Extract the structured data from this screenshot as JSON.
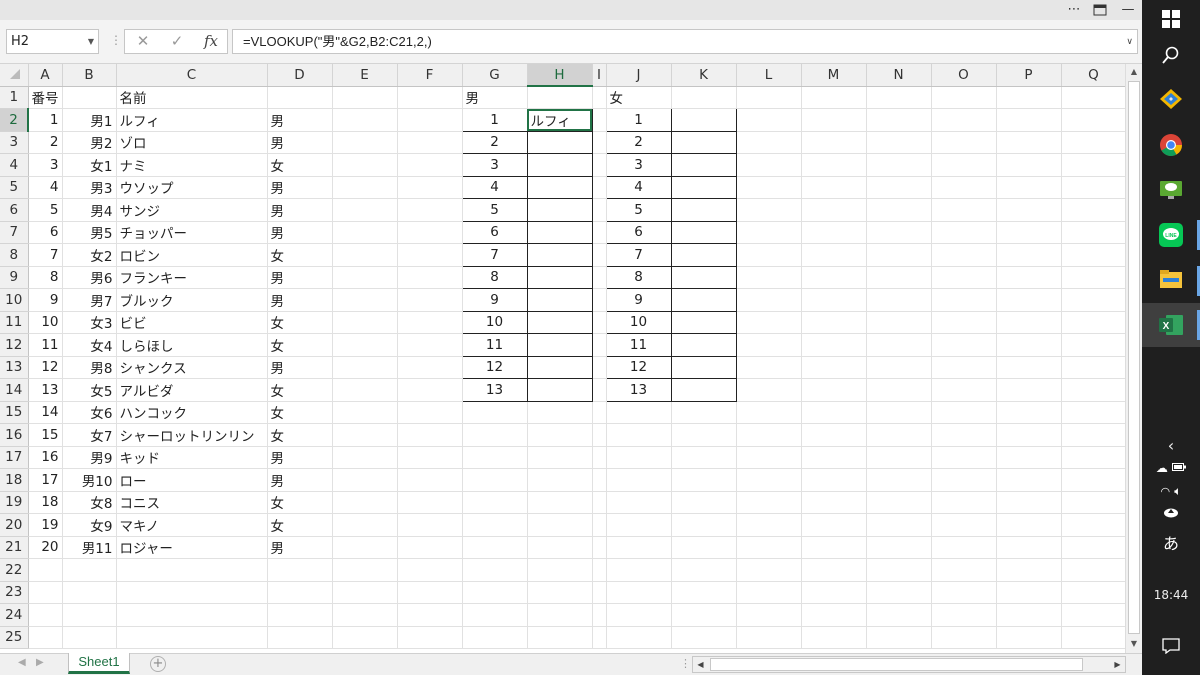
{
  "window": {
    "more_icon": "more-icon",
    "restore_icon": "restore-icon",
    "minimize_icon": "minimize-icon"
  },
  "formula_bar": {
    "name_box": "H2",
    "cancel_icon": "✕",
    "enter_icon": "✓",
    "fx_label": "fx",
    "formula": "=VLOOKUP(\"男\"&G2,B2:C21,2,)"
  },
  "columns": [
    "A",
    "B",
    "C",
    "D",
    "E",
    "F",
    "G",
    "H",
    "I",
    "J",
    "K",
    "L",
    "M",
    "N",
    "O",
    "P",
    "Q"
  ],
  "selected_column": "H",
  "selected_row": 2,
  "row_numbers": [
    1,
    2,
    3,
    4,
    5,
    6,
    7,
    8,
    9,
    10,
    11,
    12,
    13,
    14,
    15,
    16,
    17,
    18,
    19,
    20,
    21,
    22,
    23,
    24,
    25
  ],
  "header_row": {
    "A": "番号",
    "C": "名前",
    "G": "男",
    "J": "女"
  },
  "members": [
    {
      "no": "1",
      "code": "男1",
      "name": "ルフィ",
      "gender": "男"
    },
    {
      "no": "2",
      "code": "男2",
      "name": "ゾロ",
      "gender": "男"
    },
    {
      "no": "3",
      "code": "女1",
      "name": "ナミ",
      "gender": "女"
    },
    {
      "no": "4",
      "code": "男3",
      "name": "ウソップ",
      "gender": "男"
    },
    {
      "no": "5",
      "code": "男4",
      "name": "サンジ",
      "gender": "男"
    },
    {
      "no": "6",
      "code": "男5",
      "name": "チョッパー",
      "gender": "男"
    },
    {
      "no": "7",
      "code": "女2",
      "name": "ロビン",
      "gender": "女"
    },
    {
      "no": "8",
      "code": "男6",
      "name": "フランキー",
      "gender": "男"
    },
    {
      "no": "9",
      "code": "男7",
      "name": "ブルック",
      "gender": "男"
    },
    {
      "no": "10",
      "code": "女3",
      "name": "ビビ",
      "gender": "女"
    },
    {
      "no": "11",
      "code": "女4",
      "name": "しらほし",
      "gender": "女"
    },
    {
      "no": "12",
      "code": "男8",
      "name": "シャンクス",
      "gender": "男"
    },
    {
      "no": "13",
      "code": "女5",
      "name": "アルビダ",
      "gender": "女"
    },
    {
      "no": "14",
      "code": "女6",
      "name": "ハンコック",
      "gender": "女"
    },
    {
      "no": "15",
      "code": "女7",
      "name": "シャーロットリンリン",
      "gender": "女"
    },
    {
      "no": "16",
      "code": "男9",
      "name": "キッド",
      "gender": "男"
    },
    {
      "no": "17",
      "code": "男10",
      "name": "ロー",
      "gender": "男"
    },
    {
      "no": "18",
      "code": "女8",
      "name": "コニス",
      "gender": "女"
    },
    {
      "no": "19",
      "code": "女9",
      "name": "マキノ",
      "gender": "女"
    },
    {
      "no": "20",
      "code": "男11",
      "name": "ロジャー",
      "gender": "男"
    }
  ],
  "male_table": [
    {
      "n": "1",
      "name": "ルフィ"
    },
    {
      "n": "2",
      "name": ""
    },
    {
      "n": "3",
      "name": ""
    },
    {
      "n": "4",
      "name": ""
    },
    {
      "n": "5",
      "name": ""
    },
    {
      "n": "6",
      "name": ""
    },
    {
      "n": "7",
      "name": ""
    },
    {
      "n": "8",
      "name": ""
    },
    {
      "n": "9",
      "name": ""
    },
    {
      "n": "10",
      "name": ""
    },
    {
      "n": "11",
      "name": ""
    },
    {
      "n": "12",
      "name": ""
    },
    {
      "n": "13",
      "name": ""
    }
  ],
  "female_table": [
    {
      "n": "1",
      "name": ""
    },
    {
      "n": "2",
      "name": ""
    },
    {
      "n": "3",
      "name": ""
    },
    {
      "n": "4",
      "name": ""
    },
    {
      "n": "5",
      "name": ""
    },
    {
      "n": "6",
      "name": ""
    },
    {
      "n": "7",
      "name": ""
    },
    {
      "n": "8",
      "name": ""
    },
    {
      "n": "9",
      "name": ""
    },
    {
      "n": "10",
      "name": ""
    },
    {
      "n": "11",
      "name": ""
    },
    {
      "n": "12",
      "name": ""
    },
    {
      "n": "13",
      "name": ""
    }
  ],
  "sheet_tabs": [
    "Sheet1"
  ],
  "taskbar": {
    "clock": "18:44",
    "ime": "あ",
    "icons": [
      "windows-icon",
      "search-icon",
      "app-icon",
      "chrome-icon",
      "remote-desktop-icon",
      "line-icon",
      "file-explorer-icon",
      "excel-icon"
    ],
    "colors": {
      "excel_green": "#217346",
      "line_green": "#06c755",
      "chrome_red": "#db4437"
    }
  }
}
